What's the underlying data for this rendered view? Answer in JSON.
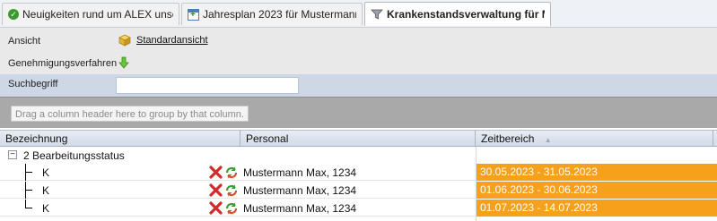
{
  "tabs": [
    {
      "label": "Neuigkeiten rund um ALEX unser...",
      "icon": "check-circle-icon"
    },
    {
      "label": "Jahresplan 2023 für Mustermann ...",
      "icon": "calendar-icon"
    },
    {
      "label": "Krankenstandsverwaltung für M...",
      "icon": "funnel-icon",
      "active": true
    }
  ],
  "filter": {
    "ansicht_label": "Ansicht",
    "ansicht_value": "Standardansicht",
    "genehmigung_label": "Genehmigungsverfahren",
    "suchbegriff_label": "Suchbegriff",
    "suchbegriff_value": ""
  },
  "group_panel": {
    "hint": "Drag a column header here to group by that column."
  },
  "grid": {
    "columns": [
      "Bezeichnung",
      "Personal",
      "Zeitbereich"
    ],
    "sort_column": "Zeitbereich",
    "sort_direction": "ascending",
    "group_label": "2 Bearbeitungsstatus",
    "rows": [
      {
        "bezeichnung": "K",
        "personal": "Mustermann Max, 1234",
        "zeitbereich": "30.05.2023 - 31.05.2023"
      },
      {
        "bezeichnung": "K",
        "personal": "Mustermann Max, 1234",
        "zeitbereich": "01.06.2023 - 30.06.2023"
      },
      {
        "bezeichnung": "K",
        "personal": "Mustermann Max, 1234",
        "zeitbereich": "01.07.2023 - 14.07.2023"
      }
    ]
  },
  "colors": {
    "zeitbereich_highlight": "#f7a01b",
    "header_bg": "#d3dbe7",
    "filter_search_row_bg": "#cdd7e6",
    "group_panel_bg": "#a9a9a9"
  }
}
